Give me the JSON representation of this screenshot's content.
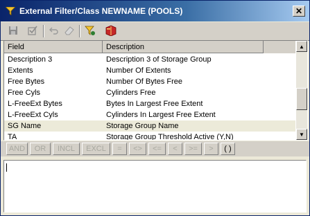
{
  "window": {
    "title": "External Filter/Class NEWNAME (POOLS)",
    "close_label": "✕"
  },
  "toolbar": {
    "buttons": [
      "save-icon",
      "check-icon",
      "undo-icon",
      "eraser-icon",
      "filter-icon",
      "book-icon"
    ]
  },
  "grid": {
    "columns": [
      "Field",
      "Description"
    ],
    "rows": [
      {
        "field": "Description 3",
        "description": "Description 3 of Storage Group"
      },
      {
        "field": "Extents",
        "description": "Number Of Extents"
      },
      {
        "field": "Free Bytes",
        "description": "Number Of Bytes Free"
      },
      {
        "field": "Free Cyls",
        "description": "Cylinders Free"
      },
      {
        "field": "L-FreeExt Bytes",
        "description": "Bytes In Largest Free Extent"
      },
      {
        "field": "L-FreeExt Cyls",
        "description": "Cylinders In Largest Free Extent"
      },
      {
        "field": "SG Name",
        "description": "Storage Group Name"
      },
      {
        "field": "TA",
        "description": "Storage Group Threshold Active (Y,N)"
      }
    ],
    "selected_row": "SG Name"
  },
  "operators": [
    "AND",
    "OR",
    "INCL",
    "EXCL",
    "=",
    "<>",
    "<=",
    "<",
    ">=",
    ">",
    "( )"
  ],
  "editor": {
    "value": ""
  },
  "colors": {
    "title_start": "#0a246a",
    "title_end": "#a6caf0",
    "face": "#d4d0c8",
    "selected_row": "#ecead9"
  }
}
